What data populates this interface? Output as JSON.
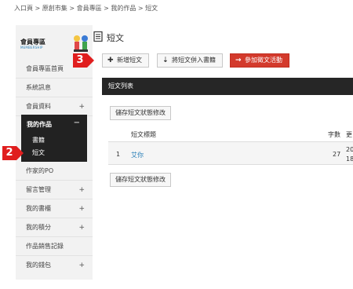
{
  "breadcrumb": "入口頁 > 原創市集 > 會員專區 > 我的作品 > 短文",
  "sidebar": {
    "title": "會員專區",
    "subtitle": "MEMBERSHIP",
    "items": [
      {
        "label": "會員專區首頁",
        "plus": ""
      },
      {
        "label": "系統訊息",
        "plus": ""
      },
      {
        "label": "會員資料",
        "plus": "+"
      }
    ],
    "active": {
      "label": "我的作品",
      "toggle": "−",
      "subs": [
        "書籍",
        "短文"
      ]
    },
    "items_after": [
      {
        "label": "作家的PO",
        "plus": ""
      },
      {
        "label": "留言管理",
        "plus": "+"
      },
      {
        "label": "我的書櫃",
        "plus": "+"
      },
      {
        "label": "我的積分",
        "plus": "+"
      },
      {
        "label": "作品銷售記錄",
        "plus": ""
      },
      {
        "label": "我的錢包",
        "plus": "+"
      }
    ]
  },
  "page_title": "短文",
  "toolbar": {
    "new_label": "新增短文",
    "merge_label": "將短文併入書籍",
    "event_label": "參加徵文活動"
  },
  "markers": {
    "m2": "2",
    "m3": "3"
  },
  "panel_title": "短文列表",
  "save_status_label": "儲存短文狀態修改",
  "table": {
    "headers": {
      "title": "短文標題",
      "words": "字數",
      "updated": "更"
    },
    "rows": [
      {
        "index": "1",
        "title": "艾你",
        "words": "27",
        "date_line1": "20",
        "date_line2": "18"
      }
    ]
  },
  "colors": {
    "accent_red": "#d33a2c",
    "marker_red": "#e01e1e",
    "link_blue": "#2a7fb8",
    "dark": "#222222"
  }
}
